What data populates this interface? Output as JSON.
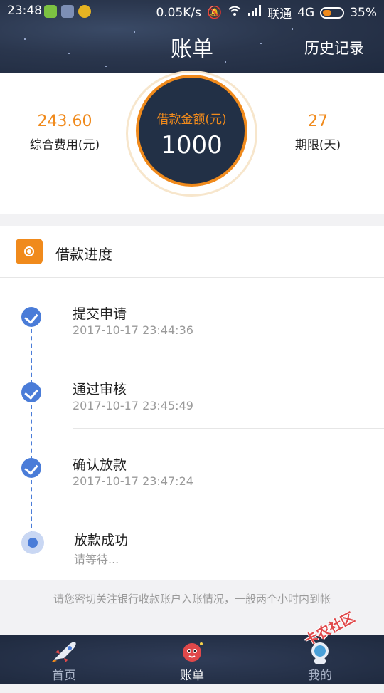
{
  "status_bar": {
    "time": "23:48",
    "network_speed": "0.05K/s",
    "carrier": "联通",
    "network_type": "4G",
    "battery": "35%"
  },
  "nav": {
    "title": "账单",
    "history_label": "历史记录"
  },
  "summary": {
    "fee_value": "243.60",
    "fee_label": "综合费用(元)",
    "amount_label": "借款金额(元)",
    "amount_value": "1000",
    "term_value": "27",
    "term_label": "期限(天)"
  },
  "progress": {
    "title": "借款进度",
    "steps": [
      {
        "title": "提交申请",
        "time": "2017-10-17 23:44:36",
        "done": true
      },
      {
        "title": "通过审核",
        "time": "2017-10-17 23:45:49",
        "done": true
      },
      {
        "title": "确认放款",
        "time": "2017-10-17 23:47:24",
        "done": true
      },
      {
        "title": "放款成功",
        "time": "请等待...",
        "done": false
      }
    ]
  },
  "notice": "请您密切关注银行收款账户入账情况，一般两个小时内到帐",
  "tabs": [
    {
      "label": "首页",
      "icon": "rocket-icon"
    },
    {
      "label": "账单",
      "icon": "planet-icon",
      "active": true
    },
    {
      "label": "我的",
      "icon": "astronaut-icon"
    }
  ],
  "watermark": "卡农社区",
  "colors": {
    "accent": "#f08a1c",
    "primary": "#4a7cd8",
    "header_bg": "#2a364d"
  }
}
